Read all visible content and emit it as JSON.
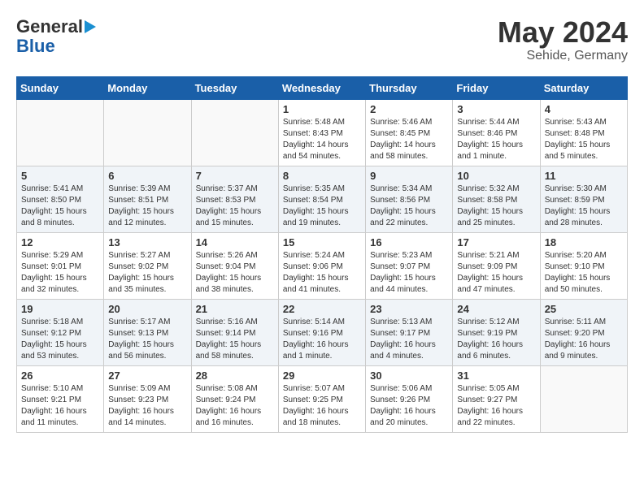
{
  "header": {
    "logo_line1": "General",
    "logo_line2": "Blue",
    "month_year": "May 2024",
    "location": "Sehide, Germany"
  },
  "weekdays": [
    "Sunday",
    "Monday",
    "Tuesday",
    "Wednesday",
    "Thursday",
    "Friday",
    "Saturday"
  ],
  "weeks": [
    [
      {
        "day": "",
        "info": ""
      },
      {
        "day": "",
        "info": ""
      },
      {
        "day": "",
        "info": ""
      },
      {
        "day": "1",
        "info": "Sunrise: 5:48 AM\nSunset: 8:43 PM\nDaylight: 14 hours\nand 54 minutes."
      },
      {
        "day": "2",
        "info": "Sunrise: 5:46 AM\nSunset: 8:45 PM\nDaylight: 14 hours\nand 58 minutes."
      },
      {
        "day": "3",
        "info": "Sunrise: 5:44 AM\nSunset: 8:46 PM\nDaylight: 15 hours\nand 1 minute."
      },
      {
        "day": "4",
        "info": "Sunrise: 5:43 AM\nSunset: 8:48 PM\nDaylight: 15 hours\nand 5 minutes."
      }
    ],
    [
      {
        "day": "5",
        "info": "Sunrise: 5:41 AM\nSunset: 8:50 PM\nDaylight: 15 hours\nand 8 minutes."
      },
      {
        "day": "6",
        "info": "Sunrise: 5:39 AM\nSunset: 8:51 PM\nDaylight: 15 hours\nand 12 minutes."
      },
      {
        "day": "7",
        "info": "Sunrise: 5:37 AM\nSunset: 8:53 PM\nDaylight: 15 hours\nand 15 minutes."
      },
      {
        "day": "8",
        "info": "Sunrise: 5:35 AM\nSunset: 8:54 PM\nDaylight: 15 hours\nand 19 minutes."
      },
      {
        "day": "9",
        "info": "Sunrise: 5:34 AM\nSunset: 8:56 PM\nDaylight: 15 hours\nand 22 minutes."
      },
      {
        "day": "10",
        "info": "Sunrise: 5:32 AM\nSunset: 8:58 PM\nDaylight: 15 hours\nand 25 minutes."
      },
      {
        "day": "11",
        "info": "Sunrise: 5:30 AM\nSunset: 8:59 PM\nDaylight: 15 hours\nand 28 minutes."
      }
    ],
    [
      {
        "day": "12",
        "info": "Sunrise: 5:29 AM\nSunset: 9:01 PM\nDaylight: 15 hours\nand 32 minutes."
      },
      {
        "day": "13",
        "info": "Sunrise: 5:27 AM\nSunset: 9:02 PM\nDaylight: 15 hours\nand 35 minutes."
      },
      {
        "day": "14",
        "info": "Sunrise: 5:26 AM\nSunset: 9:04 PM\nDaylight: 15 hours\nand 38 minutes."
      },
      {
        "day": "15",
        "info": "Sunrise: 5:24 AM\nSunset: 9:06 PM\nDaylight: 15 hours\nand 41 minutes."
      },
      {
        "day": "16",
        "info": "Sunrise: 5:23 AM\nSunset: 9:07 PM\nDaylight: 15 hours\nand 44 minutes."
      },
      {
        "day": "17",
        "info": "Sunrise: 5:21 AM\nSunset: 9:09 PM\nDaylight: 15 hours\nand 47 minutes."
      },
      {
        "day": "18",
        "info": "Sunrise: 5:20 AM\nSunset: 9:10 PM\nDaylight: 15 hours\nand 50 minutes."
      }
    ],
    [
      {
        "day": "19",
        "info": "Sunrise: 5:18 AM\nSunset: 9:12 PM\nDaylight: 15 hours\nand 53 minutes."
      },
      {
        "day": "20",
        "info": "Sunrise: 5:17 AM\nSunset: 9:13 PM\nDaylight: 15 hours\nand 56 minutes."
      },
      {
        "day": "21",
        "info": "Sunrise: 5:16 AM\nSunset: 9:14 PM\nDaylight: 15 hours\nand 58 minutes."
      },
      {
        "day": "22",
        "info": "Sunrise: 5:14 AM\nSunset: 9:16 PM\nDaylight: 16 hours\nand 1 minute."
      },
      {
        "day": "23",
        "info": "Sunrise: 5:13 AM\nSunset: 9:17 PM\nDaylight: 16 hours\nand 4 minutes."
      },
      {
        "day": "24",
        "info": "Sunrise: 5:12 AM\nSunset: 9:19 PM\nDaylight: 16 hours\nand 6 minutes."
      },
      {
        "day": "25",
        "info": "Sunrise: 5:11 AM\nSunset: 9:20 PM\nDaylight: 16 hours\nand 9 minutes."
      }
    ],
    [
      {
        "day": "26",
        "info": "Sunrise: 5:10 AM\nSunset: 9:21 PM\nDaylight: 16 hours\nand 11 minutes."
      },
      {
        "day": "27",
        "info": "Sunrise: 5:09 AM\nSunset: 9:23 PM\nDaylight: 16 hours\nand 14 minutes."
      },
      {
        "day": "28",
        "info": "Sunrise: 5:08 AM\nSunset: 9:24 PM\nDaylight: 16 hours\nand 16 minutes."
      },
      {
        "day": "29",
        "info": "Sunrise: 5:07 AM\nSunset: 9:25 PM\nDaylight: 16 hours\nand 18 minutes."
      },
      {
        "day": "30",
        "info": "Sunrise: 5:06 AM\nSunset: 9:26 PM\nDaylight: 16 hours\nand 20 minutes."
      },
      {
        "day": "31",
        "info": "Sunrise: 5:05 AM\nSunset: 9:27 PM\nDaylight: 16 hours\nand 22 minutes."
      },
      {
        "day": "",
        "info": ""
      }
    ]
  ]
}
